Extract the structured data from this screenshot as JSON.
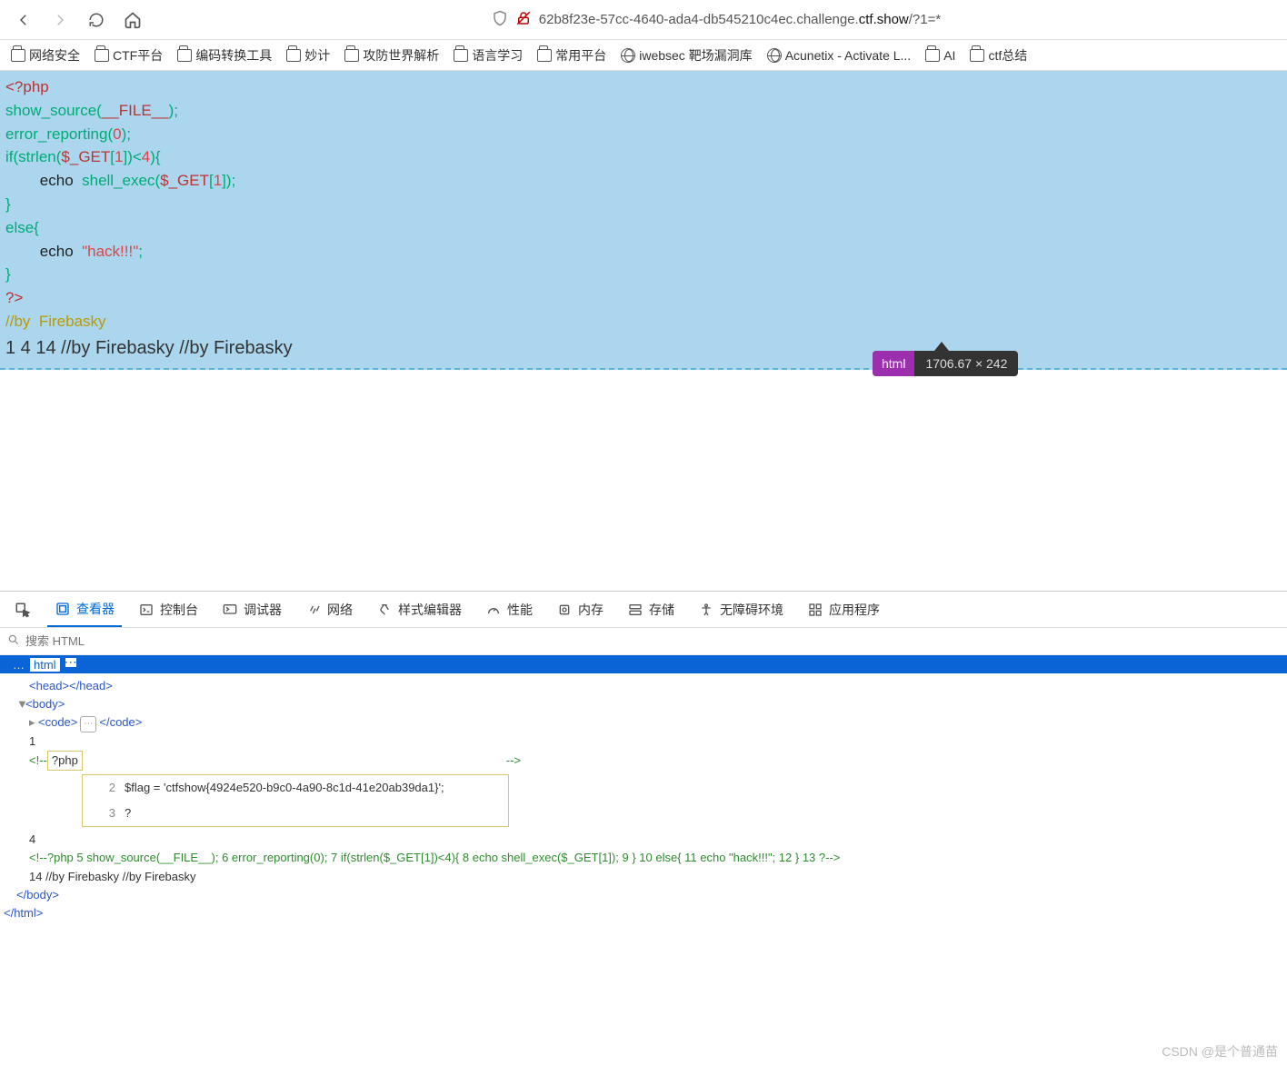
{
  "browser": {
    "url_prefix": "62b8f23e-57cc-4640-ada4-db545210c4ec.challenge.",
    "url_host_bold": "ctf.show",
    "url_suffix": "/?1=*"
  },
  "bookmarks": [
    {
      "label": "网络安全",
      "icon": "folder"
    },
    {
      "label": "CTF平台",
      "icon": "folder"
    },
    {
      "label": "编码转换工具",
      "icon": "folder"
    },
    {
      "label": "妙计",
      "icon": "folder"
    },
    {
      "label": "攻防世界解析",
      "icon": "folder"
    },
    {
      "label": "语言学习",
      "icon": "folder"
    },
    {
      "label": "常用平台",
      "icon": "folder"
    },
    {
      "label": "iwebsec 靶场漏洞库",
      "icon": "globe"
    },
    {
      "label": "Acunetix - Activate L...",
      "icon": "globe"
    },
    {
      "label": "AI",
      "icon": "folder"
    },
    {
      "label": "ctf总结",
      "icon": "folder"
    }
  ],
  "source_code": {
    "l1_open": "<?php",
    "l2_a": "show_source",
    "l2_b": "(",
    "l2_c": "__FILE__",
    "l2_d": ");",
    "l3_a": "error_reporting",
    "l3_b": "(",
    "l3_c": "0",
    "l3_d": ");",
    "l4_a": "if(",
    "l4_b": "strlen",
    "l4_c": "(",
    "l4_d": "$_GET",
    "l4_e": "[",
    "l4_f": "1",
    "l4_g": "])<",
    "l4_h": "4",
    "l4_i": "){",
    "l5_a": "        echo  ",
    "l5_b": "shell_exec",
    "l5_c": "(",
    "l5_d": "$_GET",
    "l5_e": "[",
    "l5_f": "1",
    "l5_g": "]);",
    "l6": "}",
    "l7": "else{",
    "l8_a": "        echo  ",
    "l8_b": "\"hack!!!\"",
    "l8_c": ";",
    "l9": "}",
    "l10": "?>",
    "l11": "//by  Firebasky"
  },
  "page_output": "1 4 14 //by Firebasky //by Firebasky",
  "tooltip": {
    "tag": "html",
    "dims": "1706.67 × 242"
  },
  "devtools": {
    "tabs": [
      "查看器",
      "控制台",
      "调试器",
      "网络",
      "样式编辑器",
      "性能",
      "内存",
      "存储",
      "无障碍环境",
      "应用程序"
    ],
    "search_placeholder": "搜索 HTML",
    "breadcrumb": "html",
    "dom": {
      "head": "<head></head>",
      "body_open": "<body>",
      "code_open": "<code>",
      "code_close": "</code>",
      "txt_1": "1",
      "cmt_open": "<!--",
      "cmt_q": "?php",
      "flag_ln2": "2",
      "flag_code": "$flag = 'ctfshow{4924e520-b9c0-4a90-8c1d-41e20ab39da1}';",
      "flag_ln3": "3",
      "flag_q": "?",
      "cmt_close": "-->",
      "txt_4": "4",
      "long_cmt": "<!--?php 5 show_source(__FILE__); 6 error_reporting(0); 7 if(strlen($_GET[1])<4){ 8 echo shell_exec($_GET[1]); 9 } 10 else{ 11 echo \"hack!!!\"; 12 } 13 ?-->",
      "txt_14": "14 //by Firebasky //by Firebasky",
      "body_close": "</body>",
      "html_close": "</html>"
    }
  },
  "watermark": "CSDN @是个普通苗"
}
